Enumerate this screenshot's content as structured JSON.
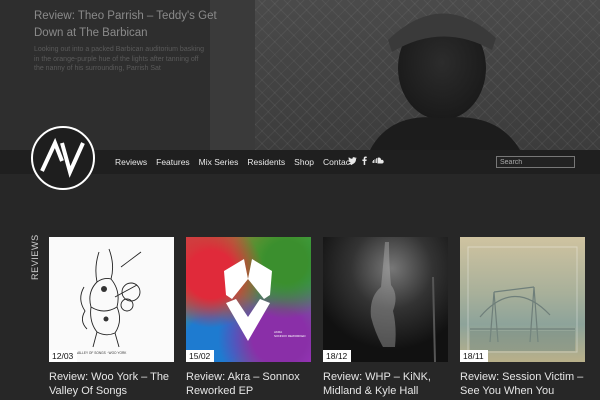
{
  "hero": {
    "title": "Review: Theo Parrish – Teddy's Get Down at The Barbican",
    "excerpt": "Looking out into a packed Barbican auditorium basking in the orange-purple hue of the lights after tanning off the nanny of his surrounding, Parrish Sat"
  },
  "nav": {
    "items": [
      "Reviews",
      "Features",
      "Mix Series",
      "Residents",
      "Shop",
      "Contact"
    ],
    "social": [
      "twitter-icon",
      "facebook-icon",
      "soundcloud-icon"
    ]
  },
  "search": {
    "placeholder": "Search"
  },
  "section_label": "REVIEWS",
  "cards": [
    {
      "date": "12/03",
      "title": "Review: Woo York – The Valley Of Songs"
    },
    {
      "date": "15/02",
      "title": "Review: Akra – Sonnox Reworked EP"
    },
    {
      "date": "18/12",
      "title": "Review: WHP – KiNK, Midland & Kyle Hall"
    },
    {
      "date": "18/11",
      "title": "Review: Session Victim – See You When You"
    }
  ],
  "colors": {
    "background": "#272727",
    "navbar": "#1f1f1f",
    "date_badge": "#ffffff"
  }
}
